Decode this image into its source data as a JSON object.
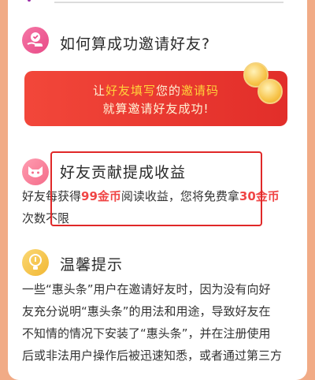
{
  "section_how": {
    "title": "如何算成功邀请好友?",
    "banner": {
      "prefix": "让",
      "hl1": "好友填写",
      "mid": "您的",
      "hl2": "邀请码",
      "line2": "就算邀请好友成功!"
    }
  },
  "section_earn": {
    "title": "好友贡献提成收益",
    "d1_a": "好友每获得",
    "d1_b": "99金币",
    "d1_c": "阅读收益，您将免费拿",
    "d1_d": "30金币",
    "d2": "次数不限"
  },
  "section_tips": {
    "title": "温馨提示",
    "lines": [
      "一些“惠头条”用户在邀请好友时，因为没有向好",
      "友充分说明“惠头条”的用法和用途，导致好友在",
      "不知情的情况下安装了“惠头条”，并在注册使用",
      "后或非法用户操作后被迅速知悉，或者通过第三方"
    ]
  },
  "colors": {
    "page_bg": "#f1ab86",
    "card_bg": "#ffffff",
    "banner_red": "#e8372f",
    "highlight_gold": "#ffd23a",
    "amount_red": "#f04545",
    "annotation_box": "#e02828"
  }
}
